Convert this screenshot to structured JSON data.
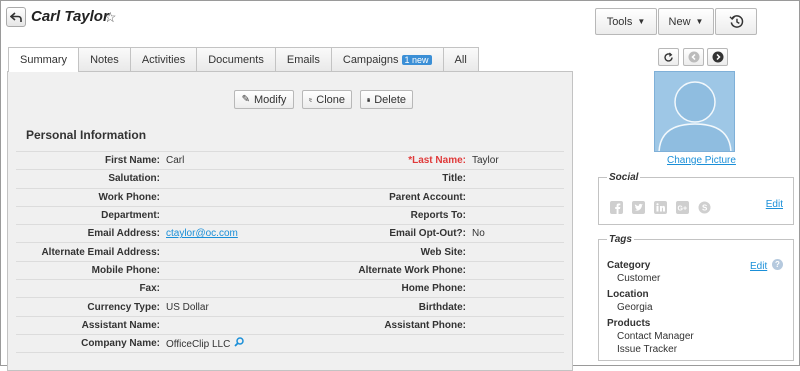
{
  "header": {
    "contact_name": "Carl Taylor",
    "tools_label": "Tools",
    "new_label": "New"
  },
  "tabs": [
    {
      "label": "Summary",
      "active": true
    },
    {
      "label": "Notes"
    },
    {
      "label": "Activities"
    },
    {
      "label": "Documents"
    },
    {
      "label": "Emails"
    },
    {
      "label": "Campaigns",
      "badge": "1 new"
    },
    {
      "label": "All"
    }
  ],
  "actions": {
    "modify_label": "Modify",
    "clone_label": "Clone",
    "delete_label": "Delete"
  },
  "section": {
    "title": "Personal Information"
  },
  "fields": {
    "first_name_label": "First Name:",
    "first_name": "Carl",
    "last_name_label": "*Last Name:",
    "last_name": "Taylor",
    "salutation_label": "Salutation:",
    "salutation": "",
    "title_label": "Title:",
    "title": "",
    "work_phone_label": "Work Phone:",
    "work_phone": "",
    "parent_account_label": "Parent Account:",
    "parent_account": "",
    "department_label": "Department:",
    "department": "",
    "reports_to_label": "Reports To:",
    "reports_to": "",
    "email_label": "Email Address:",
    "email": "ctaylor@oc.com",
    "email_opt_out_label": "Email Opt-Out?:",
    "email_opt_out": "No",
    "alt_email_label": "Alternate Email Address:",
    "alt_email": "",
    "website_label": "Web Site:",
    "website": "",
    "mobile_label": "Mobile Phone:",
    "mobile": "",
    "alt_work_phone_label": "Alternate Work Phone:",
    "alt_work_phone": "",
    "fax_label": "Fax:",
    "fax": "",
    "home_phone_label": "Home Phone:",
    "home_phone": "",
    "currency_label": "Currency Type:",
    "currency": "US Dollar",
    "birthdate_label": "Birthdate:",
    "birthdate": "",
    "assistant_name_label": "Assistant Name:",
    "assistant_name": "",
    "assistant_phone_label": "Assistant Phone:",
    "assistant_phone": "",
    "company_label": "Company Name:",
    "company": "OfficeClip LLC"
  },
  "picture": {
    "change_label": "Change Picture"
  },
  "social": {
    "title": "Social",
    "edit_label": "Edit",
    "icons": [
      "facebook-icon",
      "twitter-icon",
      "linkedin-icon",
      "google-plus-icon",
      "skype-icon"
    ]
  },
  "tags": {
    "title": "Tags",
    "edit_label": "Edit",
    "groups": [
      {
        "name": "Category",
        "items": [
          "Customer"
        ]
      },
      {
        "name": "Location",
        "items": [
          "Georgia"
        ]
      },
      {
        "name": "Products",
        "items": [
          "Contact Manager",
          "Issue Tracker"
        ]
      }
    ]
  },
  "colors": {
    "accent": "#1a8fd8",
    "badge": "#3b8fd6",
    "required": "#e03a3a",
    "avatar_bg": "#9ec7e6"
  }
}
